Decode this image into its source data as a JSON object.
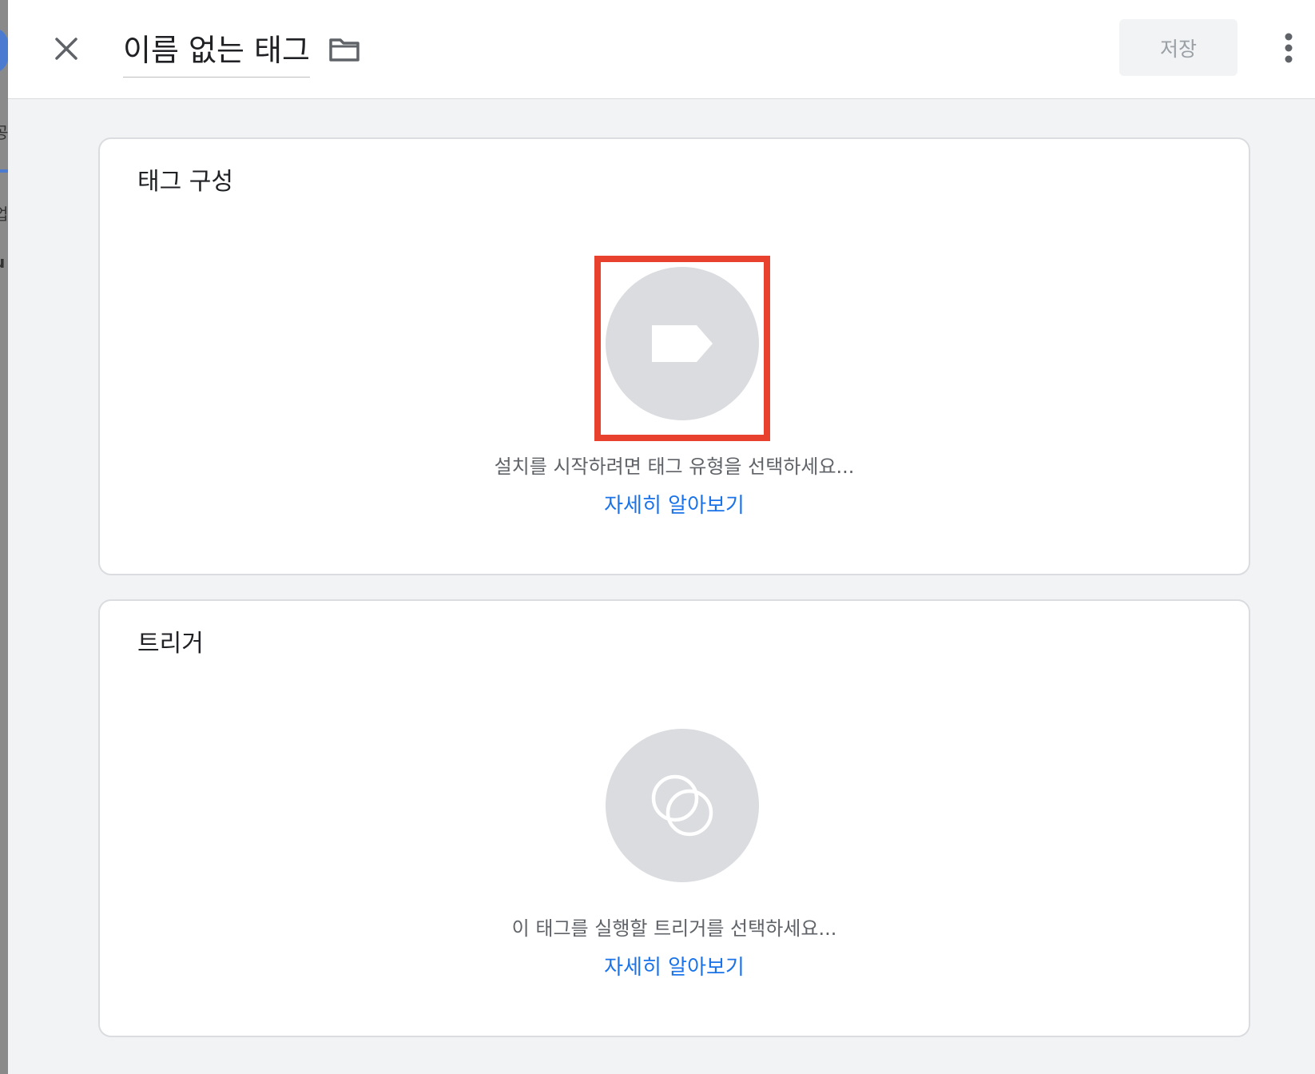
{
  "header": {
    "title": "이름 없는 태그",
    "save_label": "저장"
  },
  "tag_config": {
    "title": "태그 구성",
    "prompt": "설치를 시작하려면 태그 유형을 선택하세요...",
    "learn_more": "자세히 알아보기"
  },
  "triggering": {
    "title": "트리거",
    "prompt": "이 태그를 실행할 트리거를 선택하세요...",
    "learn_more": "자세히 알아보기"
  },
  "backdrop": {
    "fragments": [
      "공",
      "업",
      "u"
    ]
  },
  "icons": {
    "close": "close-icon",
    "folder": "folder-icon",
    "more": "more-vert-icon",
    "tag_type": "tag-icon",
    "trigger": "trigger-icon"
  },
  "colors": {
    "accent_link": "#1a73e8",
    "highlight": "#e8412e",
    "placeholder": "#dadce0"
  }
}
